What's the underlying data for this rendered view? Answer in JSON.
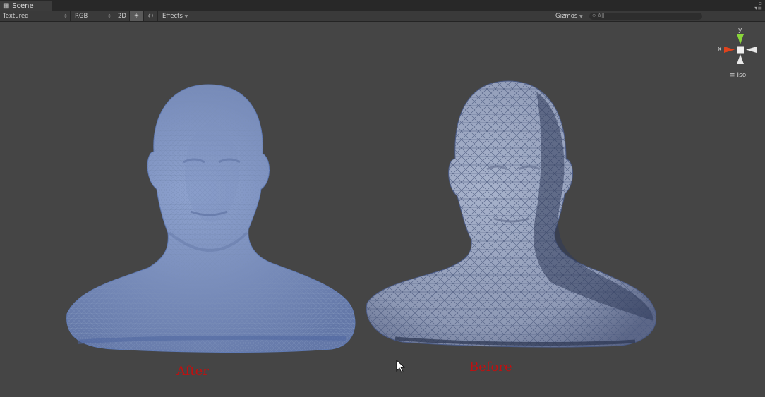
{
  "window": {
    "tab_title": "Scene"
  },
  "toolbar": {
    "shading_mode": "Textured",
    "render_mode": "RGB",
    "mode_2d": "2D",
    "effects_label": "Effects",
    "gizmos_label": "Gizmos",
    "search_placeholder": "All"
  },
  "gizmo": {
    "x_label": "x",
    "y_label": "y",
    "projection_label": "Iso"
  },
  "viewport": {
    "left_label": "After",
    "right_label": "Before"
  }
}
